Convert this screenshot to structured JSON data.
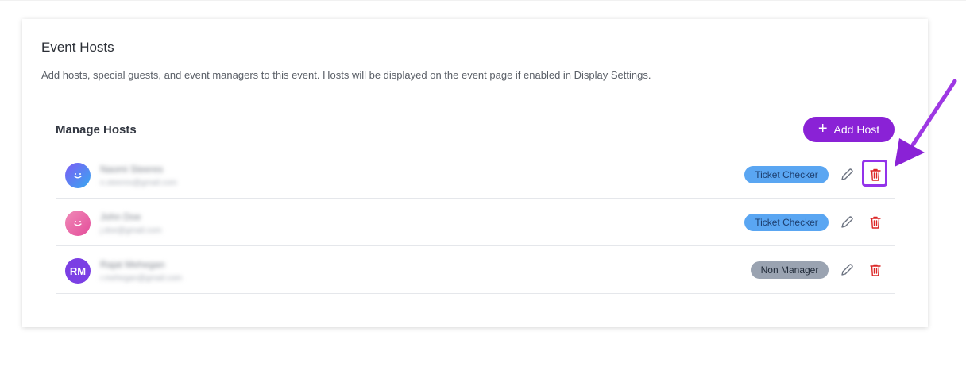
{
  "card": {
    "title": "Event Hosts",
    "description": "Add hosts, special guests, and event managers to this event. Hosts will be displayed on the event page if enabled in Display Settings."
  },
  "manage": {
    "title": "Manage Hosts",
    "add_button_label": "Add Host",
    "add_button_icon": "plus-icon"
  },
  "hosts": [
    {
      "name": "Naomi Steeres",
      "email": "n.steeres@gmail.com",
      "avatar": "smile-icon",
      "role": "Ticket Checker",
      "role_color": "#5aa6f2"
    },
    {
      "name": "John Doe",
      "email": "j.doe@gmail.com",
      "avatar": "smile-icon",
      "role": "Ticket Checker",
      "role_color": "#5aa6f2"
    },
    {
      "name": "Rajat Mehegan",
      "email": "r.mehegan@gmail.com",
      "avatar_initials": "RM",
      "role": "Non Manager",
      "role_color": "#9aa3b1"
    }
  ],
  "colors": {
    "accent": "#8a22d6",
    "delete": "#dc2626",
    "highlight": "#9333ea"
  }
}
